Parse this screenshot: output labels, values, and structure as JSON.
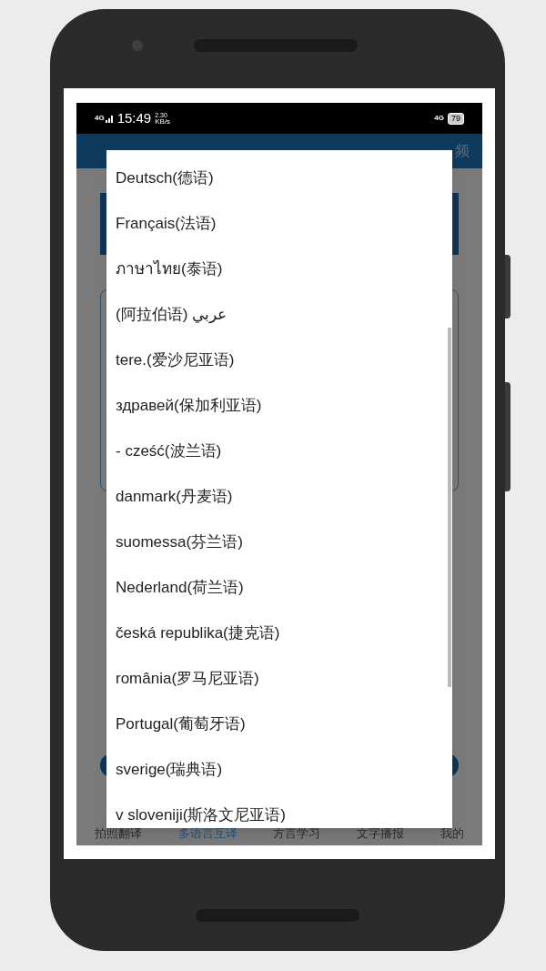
{
  "status_bar": {
    "network": "4G",
    "time": "15:49",
    "speed": "2.30",
    "speed_unit": "KB/s",
    "network_right": "4G",
    "battery": "79"
  },
  "header": {
    "action_fragment": "频"
  },
  "language_dialog": {
    "items": [
      {
        "label": "Deutsch(德语)"
      },
      {
        "label": "Français(法语)"
      },
      {
        "label": "ภาษาไทย(泰语)"
      },
      {
        "label": "(阿拉伯语) عربي"
      },
      {
        "label": "tere.(爱沙尼亚语)"
      },
      {
        "label": "здравей(保加利亚语)"
      },
      {
        "label": "- cześć(波兰语)"
      },
      {
        "label": "danmark(丹麦语)"
      },
      {
        "label": "suomessa(芬兰语)"
      },
      {
        "label": "Nederland(荷兰语)"
      },
      {
        "label": "česká republika(捷克语)"
      },
      {
        "label": "românia(罗马尼亚语)"
      },
      {
        "label": "Portugal(葡萄牙语)"
      },
      {
        "label": "sverige(瑞典语)"
      },
      {
        "label": "v slovenijі(斯洛文尼亚语)"
      }
    ]
  },
  "bottom_nav": [
    {
      "label": "拍照翻译",
      "selected": false
    },
    {
      "label": "多语言互译",
      "selected": true
    },
    {
      "label": "方言学习",
      "selected": false
    },
    {
      "label": "文字播报",
      "selected": false
    },
    {
      "label": "我的",
      "selected": false
    }
  ]
}
